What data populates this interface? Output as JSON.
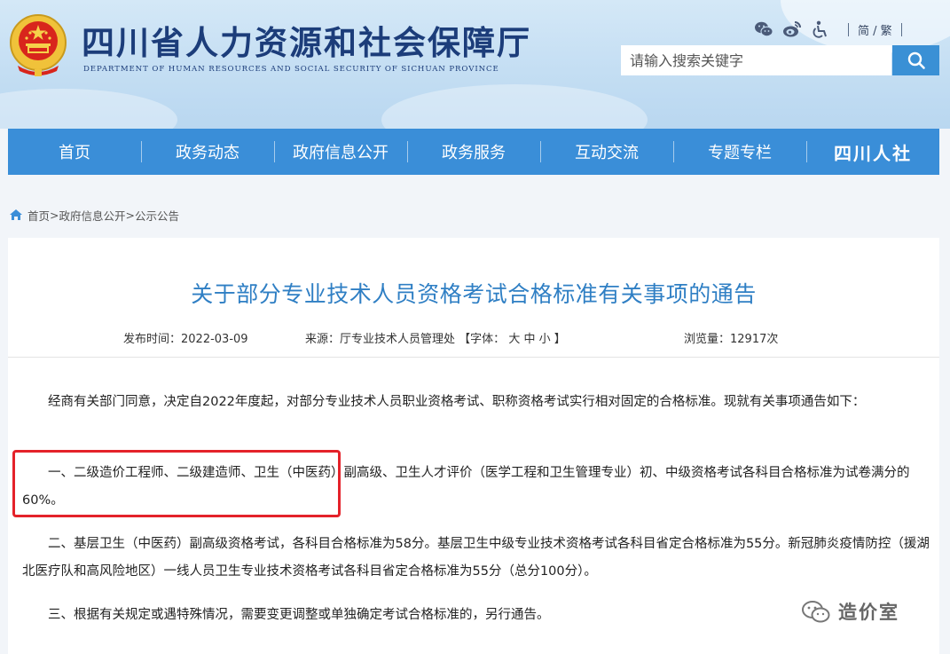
{
  "header": {
    "site_title": "四川省人力资源和社会保障厅",
    "site_subtitle": "DEPARTMENT OF HUMAN RESOURCES AND SOCIAL SECURITY OF SICHUAN PROVINCE",
    "lang_toggle": "简 / 繁",
    "icons": [
      "wechat-icon",
      "weibo-icon",
      "accessibility-icon"
    ],
    "search": {
      "placeholder": "请输入搜索关键字",
      "button_icon": "search-icon"
    }
  },
  "nav": {
    "items": [
      "首页",
      "政务动态",
      "政府信息公开",
      "政务服务",
      "互动交流",
      "专题专栏"
    ],
    "brand": "四川人社"
  },
  "breadcrumb": {
    "icon": "home-icon",
    "items": [
      "首页",
      "政府信息公开",
      "公示公告"
    ],
    "separator": ">"
  },
  "article": {
    "title": "关于部分专业技术人员资格考试合格标准有关事项的通告",
    "publish_label": "发布时间：",
    "publish_date": "2022-03-09",
    "source_label": "来源：",
    "source": "厅专业技术人员管理处",
    "font_label": "【字体：",
    "font_sizes": [
      "大",
      "中",
      "小"
    ],
    "font_close": "】",
    "views_label": "浏览量：",
    "views": "12917次",
    "paragraphs": [
      "经商有关部门同意，决定自2022年度起，对部分专业技术人员职业资格考试、职称资格考试实行相对固定的合格标准。现就有关事项通告如下：",
      "一、二级造价工程师、二级建造师、卫生（中医药）副高级、卫生人才评价（医学工程和卫生管理专业）初、中级资格考试各科目合格标准为试卷满分的60%。",
      "二、基层卫生（中医药）副高级资格考试，各科目合格标准为58分。基层卫生中级专业技术资格考试各科目省定合格标准为55分。新冠肺炎疫情防控（援湖北医疗队和高风险地区）一线人员卫生专业技术资格考试各科目省定合格标准为55分（总分100分）。",
      "三、根据有关规定或遇特殊情况，需要变更调整或单独确定考试合格标准的，另行通告。"
    ]
  },
  "watermark": {
    "text": "造价室",
    "icon": "wechat-icon"
  },
  "colors": {
    "nav_bg": "#3a8ed8",
    "title_blue": "#2f7fc4",
    "highlight_red": "#e4222a",
    "header_navy": "#1c3d7a"
  }
}
